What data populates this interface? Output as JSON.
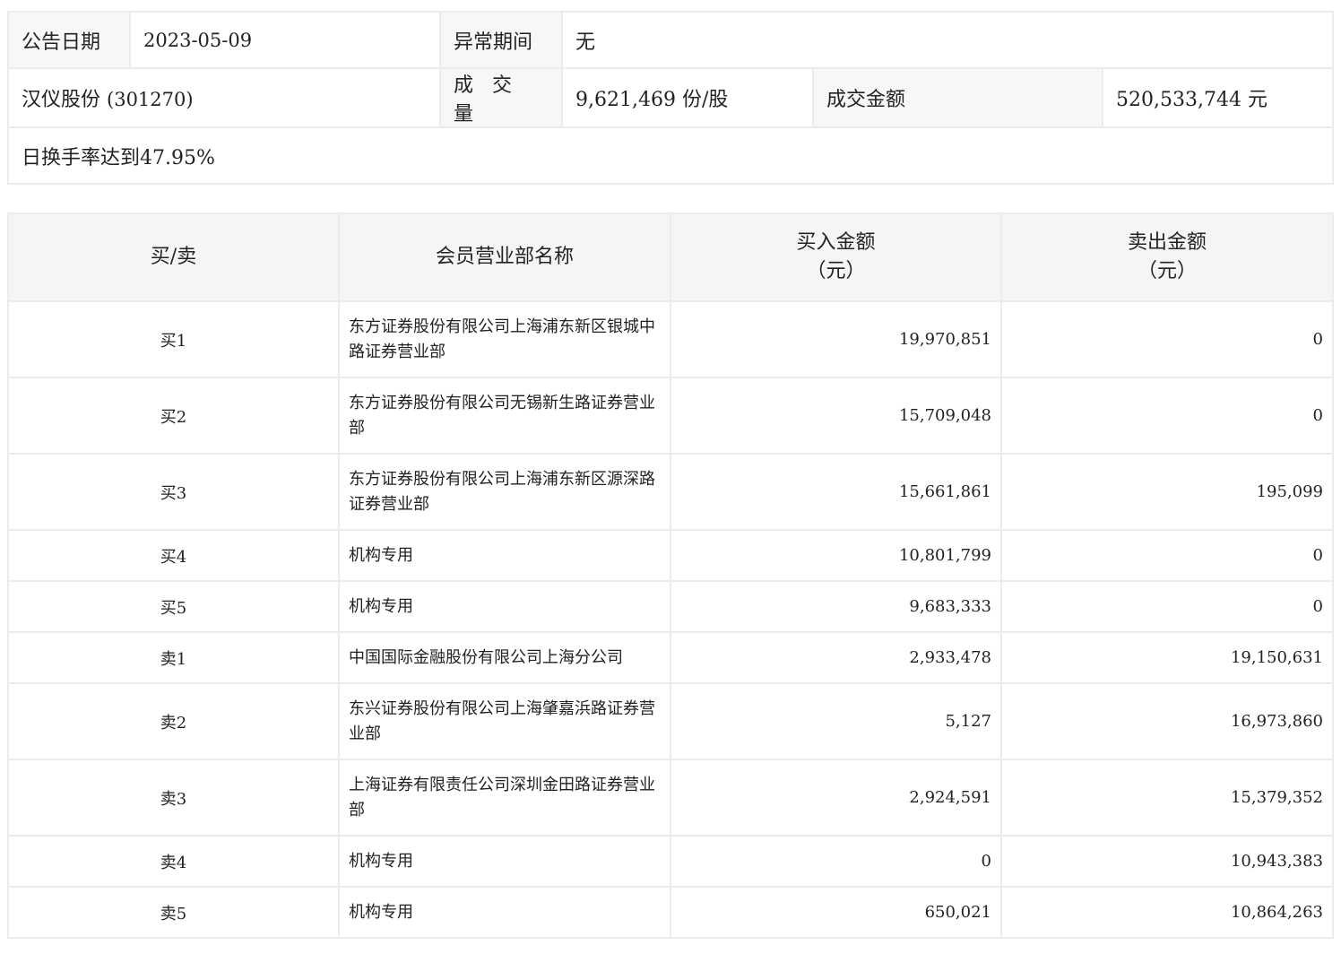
{
  "summary": {
    "date_label": "公告日期",
    "date_value": "2023-05-09",
    "abnormal_label": "异常期间",
    "abnormal_value": "无",
    "stock_name": "汉仪股份",
    "stock_code": "(301270)",
    "volume_label": "成 交 量",
    "volume_value": "9,621,469 份/股",
    "amount_label": "成交金额",
    "amount_value": "520,533,744 元",
    "reason": "日换手率达到47.95%"
  },
  "table": {
    "headers": {
      "side": "买/卖",
      "name": "会员营业部名称",
      "buy_line1": "买入金额",
      "buy_line2": "（元）",
      "sell_line1": "卖出金额",
      "sell_line2": "（元）"
    },
    "rows": [
      {
        "side": "买1",
        "name": "东方证券股份有限公司上海浦东新区银城中路证券营业部",
        "buy": "19,970,851",
        "sell": "0"
      },
      {
        "side": "买2",
        "name": "东方证券股份有限公司无锡新生路证券营业部",
        "buy": "15,709,048",
        "sell": "0"
      },
      {
        "side": "买3",
        "name": "东方证券股份有限公司上海浦东新区源深路证券营业部",
        "buy": "15,661,861",
        "sell": "195,099"
      },
      {
        "side": "买4",
        "name": "机构专用",
        "buy": "10,801,799",
        "sell": "0"
      },
      {
        "side": "买5",
        "name": "机构专用",
        "buy": "9,683,333",
        "sell": "0"
      },
      {
        "side": "卖1",
        "name": "中国国际金融股份有限公司上海分公司",
        "buy": "2,933,478",
        "sell": "19,150,631"
      },
      {
        "side": "卖2",
        "name": "东兴证券股份有限公司上海肇嘉浜路证券营业部",
        "buy": "5,127",
        "sell": "16,973,860"
      },
      {
        "side": "卖3",
        "name": "上海证券有限责任公司深圳金田路证券营业部",
        "buy": "2,924,591",
        "sell": "15,379,352"
      },
      {
        "side": "卖4",
        "name": "机构专用",
        "buy": "0",
        "sell": "10,943,383"
      },
      {
        "side": "卖5",
        "name": "机构专用",
        "buy": "650,021",
        "sell": "10,864,263"
      }
    ]
  }
}
